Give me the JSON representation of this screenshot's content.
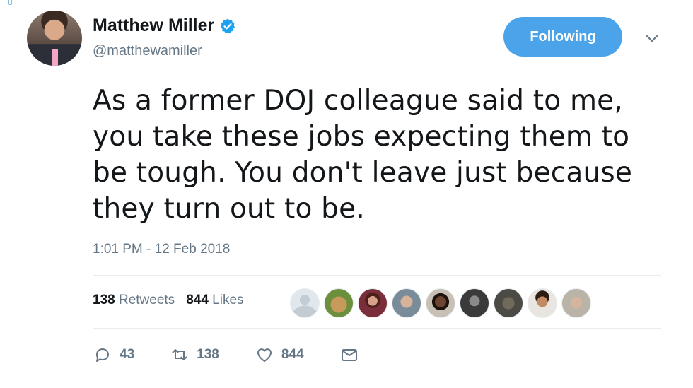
{
  "author": {
    "name": "Matthew Miller",
    "handle": "@matthewamiller",
    "verified": true
  },
  "follow_button": {
    "label": "Following"
  },
  "tweet": {
    "lines": [
      "As a former DOJ colleague said to me,",
      "you take these jobs expecting them to",
      "be tough. You don't leave just because",
      "they turn out to be."
    ],
    "timestamp": "1:01 PM - 12 Feb 2018"
  },
  "stats": {
    "retweets_count": "138",
    "retweets_label": "Retweets",
    "likes_count": "844",
    "likes_label": "Likes"
  },
  "actions": {
    "reply_count": "43",
    "retweet_count": "138",
    "like_count": "844"
  },
  "colors": {
    "accent": "#4ba3e9",
    "secondary_text": "#657786",
    "divider": "#e6ecf0"
  }
}
